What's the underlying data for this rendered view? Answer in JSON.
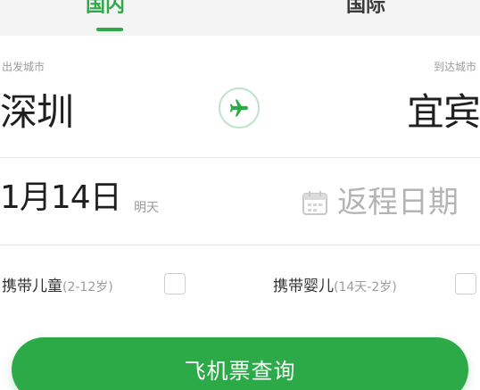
{
  "tabs": {
    "domestic": "国内",
    "international": "国际"
  },
  "route": {
    "from_label": "出发城市",
    "from_city": "深圳",
    "to_label": "到达城市",
    "to_city": "宜宾"
  },
  "dates": {
    "depart": "1月14日",
    "depart_note": "明天",
    "return_placeholder": "返程日期"
  },
  "passengers": {
    "child_label": "携带儿童",
    "child_age": "(2-12岁)",
    "infant_label": "携带婴儿",
    "infant_age": "(14天-2岁)"
  },
  "search_button": "飞机票查询",
  "colors": {
    "accent": "#2caa48",
    "muted_text": "#9c9c9c"
  },
  "icons": {
    "swap": "plane-icon",
    "calendar": "calendar-icon"
  }
}
